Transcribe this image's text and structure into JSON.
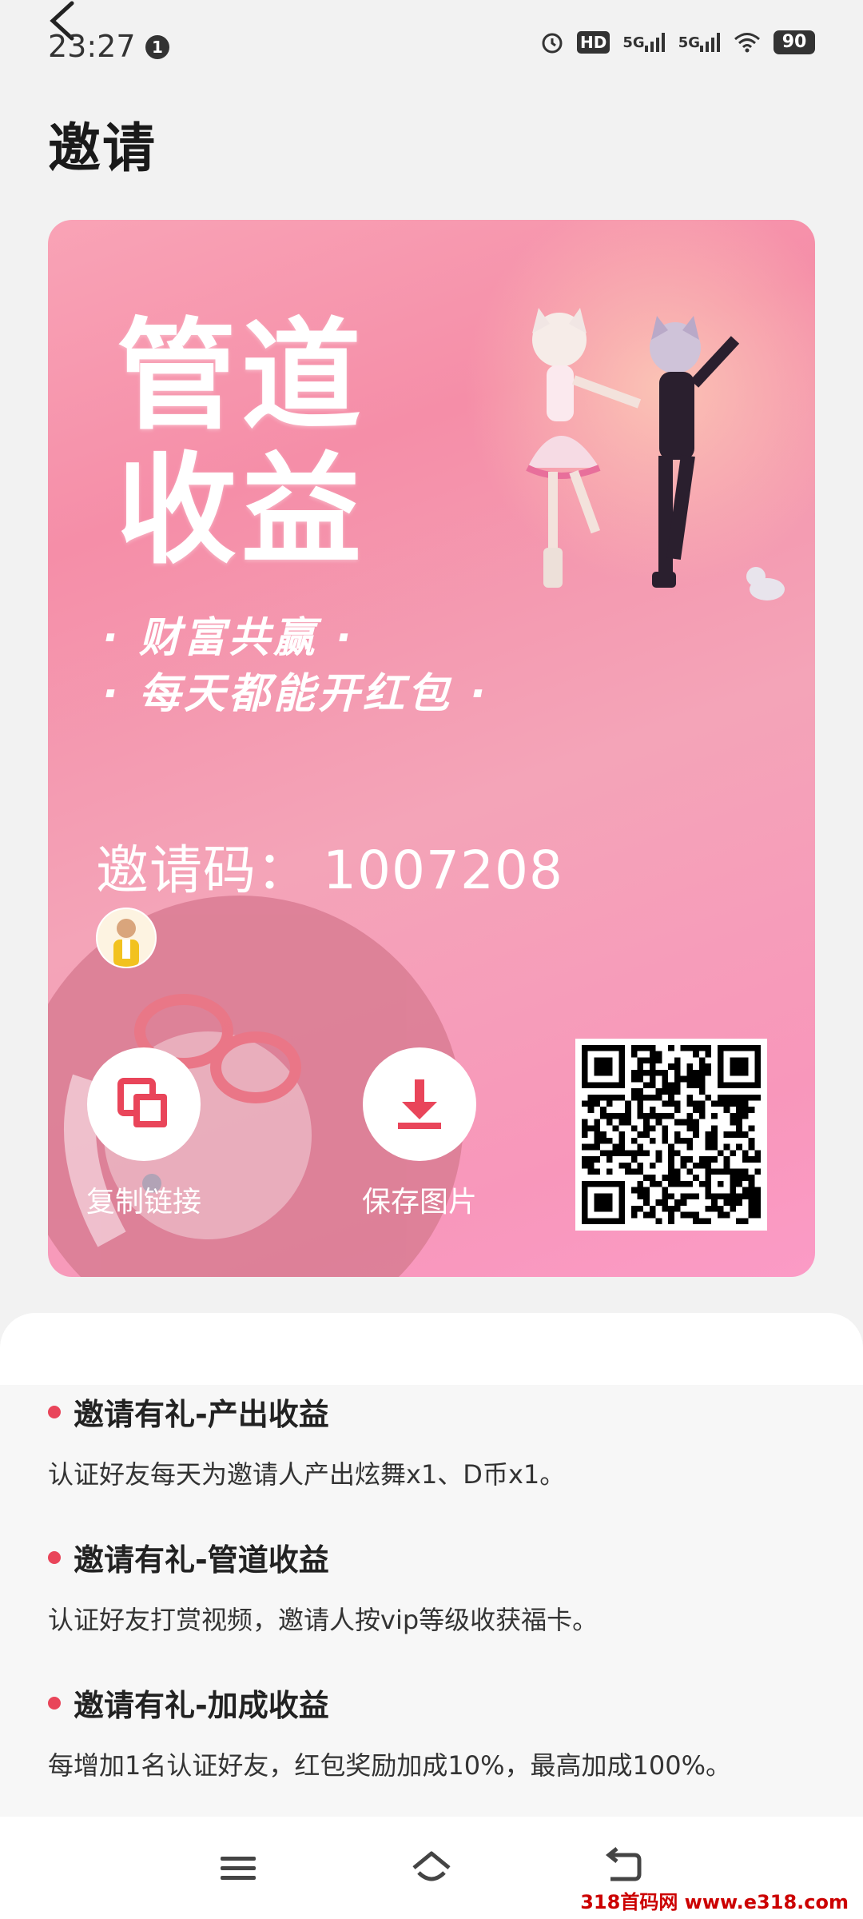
{
  "status_bar": {
    "time": "23:27",
    "notification_count": "1",
    "network_1": "5G",
    "network_2": "5G",
    "hd_label": "HD",
    "battery": "90"
  },
  "header": {
    "title": "邀请"
  },
  "poster": {
    "headline_line1": "管道",
    "headline_line2": "收益",
    "tagline1": "· 财富共赢 ·",
    "tagline2": "· 每天都能开红包 ·",
    "invite_label": "邀请码：",
    "invite_code": "1007208",
    "copy_link_label": "复制链接",
    "save_image_label": "保存图片"
  },
  "rules": [
    {
      "title": "邀请有礼-产出收益",
      "desc": "认证好友每天为邀请人产出炫舞x1、D币x1。"
    },
    {
      "title": "邀请有礼-管道收益",
      "desc": "认证好友打赏视频，邀请人按vip等级收获福卡。"
    },
    {
      "title": "邀请有礼-加成收益",
      "desc": "每增加1名认证好友，红包奖励加成10%，最高加成100%。"
    }
  ],
  "colors": {
    "accent": "#e9455a",
    "card_pink": "#f590ab"
  },
  "watermark": "318首码网 www.e318.com"
}
